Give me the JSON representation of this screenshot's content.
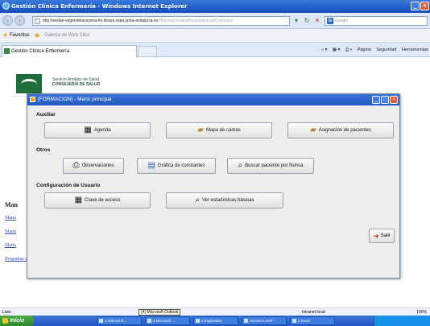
{
  "browser": {
    "title": "Gestión Clínica Enfermería - Windows Internet Explorer",
    "url": "http://eedae-virgendelavictoria-for.diraya.sspa.junta-andalucia.es",
    "url_rest": "/HistoriaDeSaludHospitalizacionCuidados/",
    "search_placeholder": "Google",
    "favorites_label": "Favoritos",
    "gallery_label": "Galería de Web Slice",
    "tab_title": "Gestión Clínica Enfermería",
    "cmd_page": "Página",
    "cmd_security": "Seguridad",
    "cmd_tools": "Herramientas"
  },
  "header": {
    "org_line1": "Servicio Andaluz de Salud",
    "org_line2": "CONSEJERÍA DE SALUD"
  },
  "page": {
    "left_heading": "Man",
    "left_links": [
      "Manu",
      "Manu",
      "Manu"
    ],
    "faq_link": "Preguntas y Respuestas Frecuentes"
  },
  "dialog": {
    "title": "[FORMACION] - Menú principal",
    "sections": {
      "auxiliar": "Auxiliar",
      "otros": "Otros",
      "config": "Configuración de Usuario"
    },
    "buttons": {
      "agenda": "Agenda",
      "mapa_camas": "Mapa de camas",
      "asignacion": "Asignación de pacientes",
      "observaciones": "Observaciones",
      "grafica": "Gráfica de constantes",
      "buscar": "Buscar paciente por Nuhsa",
      "clave": "Clave de acceso",
      "estadisticas": "Ver estadísticas básicas",
      "salir": "Salir"
    }
  },
  "status": {
    "left": "Listo",
    "tooltip": "(4) Microsoft Outlook",
    "zone": "Intranet local",
    "zoom": "100%"
  },
  "taskbar": {
    "start": "Inicio",
    "tasks": [
      "3 Internet E...",
      "3 Microsoft ...",
      "2 Explorador",
      "Acceso a SAP",
      "2 Excel"
    ]
  }
}
